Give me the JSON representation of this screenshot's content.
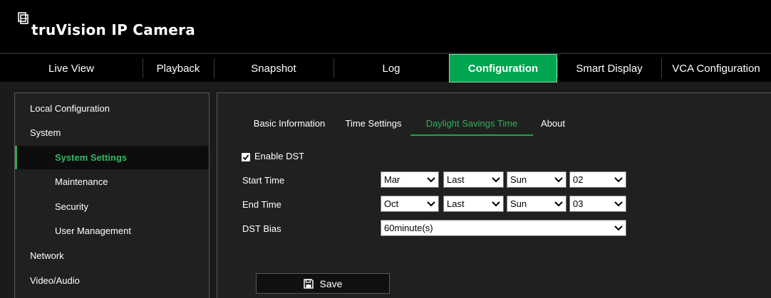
{
  "brand": {
    "name": "truVision  IP Camera"
  },
  "nav": {
    "tabs": [
      {
        "label": "Live View"
      },
      {
        "label": "Playback"
      },
      {
        "label": "Snapshot"
      },
      {
        "label": "Log"
      },
      {
        "label": "Configuration",
        "active": true
      },
      {
        "label": "Smart Display"
      },
      {
        "label": "VCA Configuration"
      }
    ]
  },
  "sidebar": {
    "items": [
      {
        "label": "Local Configuration"
      },
      {
        "label": "System"
      },
      {
        "label": "System Settings",
        "active": true
      },
      {
        "label": "Maintenance"
      },
      {
        "label": "Security"
      },
      {
        "label": "User Management"
      },
      {
        "label": "Network"
      },
      {
        "label": "Video/Audio"
      }
    ]
  },
  "subtabs": [
    {
      "label": "Basic Information"
    },
    {
      "label": "Time Settings"
    },
    {
      "label": "Daylight Savings Time",
      "active": true
    },
    {
      "label": "About"
    }
  ],
  "dst": {
    "enable_label": "Enable DST",
    "enabled": true,
    "start_label": "Start Time",
    "start": {
      "month": "Mar",
      "week": "Last",
      "day": "Sun",
      "hour": "02"
    },
    "end_label": "End Time",
    "end": {
      "month": "Oct",
      "week": "Last",
      "day": "Sun",
      "hour": "03"
    },
    "bias_label": "DST Bias",
    "bias": "60minute(s)"
  },
  "actions": {
    "save_label": "Save"
  },
  "icons": {
    "checkbox": "checkmark-icon",
    "save": "floppy-disk-icon",
    "select": "chevron-down-icon",
    "logo": "camera-logo-icon"
  },
  "colors": {
    "accent": "#00a54f",
    "active_text": "#2fae5a"
  }
}
